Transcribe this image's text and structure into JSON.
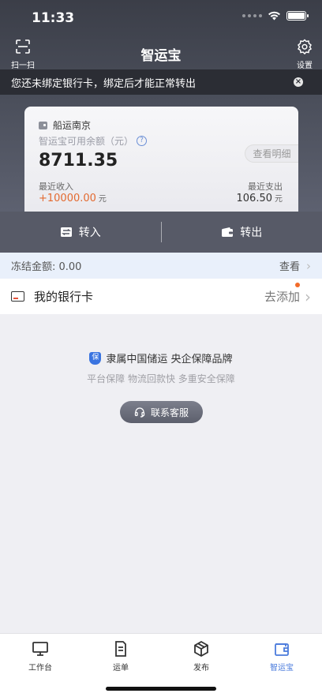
{
  "status_bar": {
    "time": "11:33"
  },
  "nav": {
    "title": "智运宝",
    "scan_label": "扫一扫",
    "settings_label": "设置"
  },
  "notice": {
    "text": "您还未绑定银行卡，绑定后才能正常转出"
  },
  "card": {
    "company": "船运南京",
    "balance_label": "智运宝可用余额（元）",
    "balance": "8711.35",
    "detail_button": "查看明细",
    "recent_income_label": "最近收入",
    "recent_income": "+10000.00",
    "recent_expense_label": "最近支出",
    "recent_expense": "106.50",
    "unit": "元"
  },
  "actions": {
    "transfer_in": "转入",
    "transfer_out": "转出"
  },
  "frozen": {
    "text": "冻结金额: 0.00",
    "view_label": "查看"
  },
  "bank": {
    "label": "我的银行卡",
    "add_label": "去添加"
  },
  "brand": {
    "badge": "保",
    "line1": "隶属中国储运 央企保障品牌",
    "line2": "平台保障 物流回款快 多重安全保障",
    "contact_button": "联系客服"
  },
  "tabbar": {
    "items": [
      {
        "label": "工作台",
        "icon": "monitor-icon",
        "active": false
      },
      {
        "label": "运单",
        "icon": "document-icon",
        "active": false
      },
      {
        "label": "发布",
        "icon": "package-icon",
        "active": false
      },
      {
        "label": "智运宝",
        "icon": "wallet-icon",
        "active": true
      }
    ]
  },
  "colors": {
    "accent": "#4a7bdc",
    "income": "#e36a30",
    "header": "#3b3e48"
  }
}
